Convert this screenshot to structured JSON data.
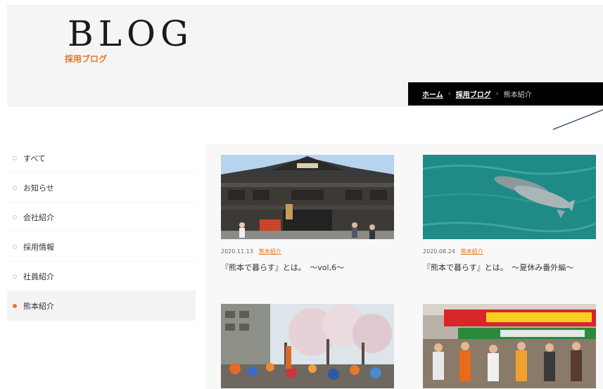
{
  "header": {
    "title": "BLOG",
    "subtitle": "採用ブログ"
  },
  "breadcrumb": {
    "home": "ホーム",
    "sep1": "›",
    "blog": "採用ブログ",
    "sep2": "›",
    "current": "熊本紹介"
  },
  "sidebar": {
    "items": [
      {
        "label": "すべて"
      },
      {
        "label": "お知らせ"
      },
      {
        "label": "会社紹介"
      },
      {
        "label": "採用情報"
      },
      {
        "label": "社員紹介"
      },
      {
        "label": "熊本紹介",
        "active": true
      }
    ]
  },
  "posts": [
    {
      "date": "2020.11.13",
      "category": "熊本紹介",
      "title": "『熊本で暮らす』とは。　〜vol,6〜"
    },
    {
      "date": "2020.08.24",
      "category": "熊本紹介",
      "title": "『熊本で暮らす』とは。　〜夏休み番外編〜"
    },
    {
      "date": "",
      "category": "",
      "title": ""
    },
    {
      "date": "",
      "category": "",
      "title": ""
    }
  ],
  "colors": {
    "accent": "#e5762a",
    "header_bg": "#f5f5f5",
    "breadcrumb_bg": "#000000"
  }
}
